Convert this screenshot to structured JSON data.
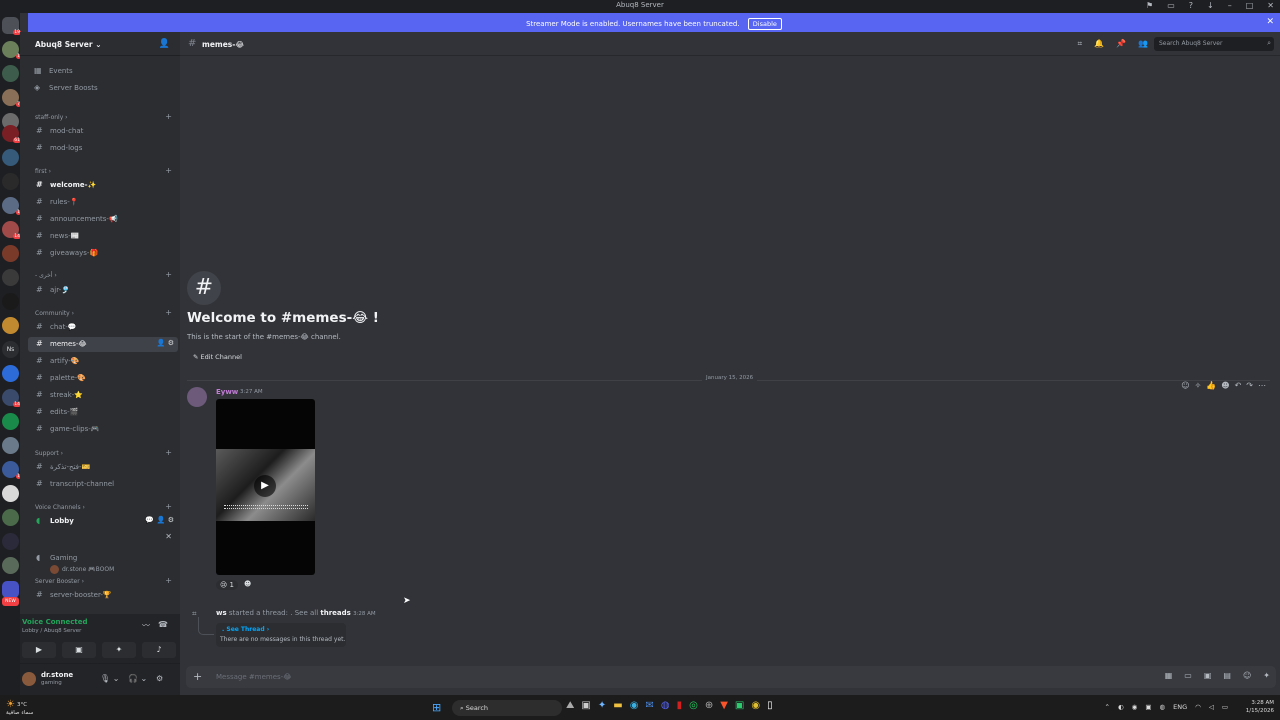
{
  "window": {
    "title": "Abuq8 Server"
  },
  "banner": {
    "text": "Streamer Mode is enabled. Usernames have been truncated.",
    "button": "Disable"
  },
  "server": {
    "name": "Abuq8 Server",
    "top_items": [
      {
        "icon": "calendar-icon",
        "label": "Events"
      },
      {
        "icon": "boost-icon",
        "label": "Server Boosts"
      }
    ]
  },
  "categories": [
    {
      "name": "staff-only",
      "channels": [
        "mod-chat",
        "mod-logs"
      ]
    },
    {
      "name": "first",
      "channels": [
        "welcome-✨",
        "rules-📍",
        "announcements-📢",
        "news-📰",
        "giveaways-🎁"
      ]
    },
    {
      "name": "- أخرى",
      "channels": [
        "ajr-🎐"
      ]
    },
    {
      "name": "Community",
      "channels": [
        "chat-💬",
        "memes-😂",
        "artify-🎨",
        "palette-🎨",
        "streak-⭐",
        "edits-🎬",
        "game-clips-🎮"
      ]
    },
    {
      "name": "Support",
      "channels": [
        "فتح-تذكرة-🎫",
        "transcript-channel"
      ]
    },
    {
      "name": "Voice Channels",
      "channels": [
        "Lobby"
      ]
    },
    {
      "name": "Server Booster",
      "channels": [
        "server-booster-🏆"
      ]
    }
  ],
  "voice": {
    "user": "dr.stone",
    "user_status": "🎮BOOM",
    "connected_label": "Voice Connected",
    "connected_sub": "Lobby / Abuq8 Server"
  },
  "user": {
    "name": "dr.stone",
    "status": "gaming"
  },
  "channel": {
    "name": "memes-😂",
    "search_placeholder": "Search Abuq8 Server",
    "welcome_title": "Welcome to #memes-😂 !",
    "welcome_sub": "This is the start of the #memes-😂 channel.",
    "edit_label": "Edit Channel",
    "date_divider": "January 15, 2026"
  },
  "message": {
    "author": "Eyww",
    "time": "3:27 AM",
    "reaction_count": "1"
  },
  "thread": {
    "author": "ws",
    "text": "started a thread:",
    "dot": ".",
    "see_all": "See all",
    "threads_word": "threads",
    "time": "3:28 AM",
    "see_thread": ". See Thread ›",
    "empty": "There are no messages in this thread yet."
  },
  "composer": {
    "placeholder": "Message #memes-😂"
  },
  "taskbar": {
    "temp": "3°C",
    "weather": "سماء صافية",
    "search": "Search",
    "lang": "ENG",
    "time": "3:28 AM",
    "date": "1/15/2026"
  }
}
